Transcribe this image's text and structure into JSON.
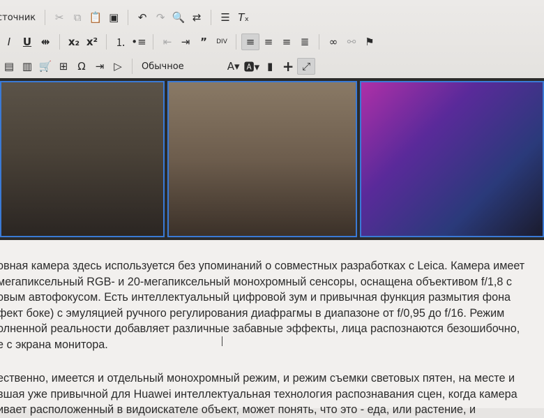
{
  "toolbar": {
    "source_label": "сточник",
    "format_label": "Обычное",
    "row1_icons": [
      "cut-icon",
      "copy-icon",
      "paste-icon",
      "paste-text-icon",
      "paste-word-icon",
      "undo-icon",
      "redo-icon",
      "find-icon",
      "replace-icon",
      "select-all-icon",
      "remove-format-icon"
    ],
    "row2_icons": [
      "italic-icon",
      "underline-icon",
      "strike-icon",
      "subscript-icon",
      "superscript-icon",
      "numbered-list-icon",
      "bulleted-list-icon",
      "outdent-icon",
      "indent-icon",
      "blockquote-icon",
      "div-icon",
      "align-left-icon",
      "align-center-icon",
      "align-right-icon",
      "justify-icon",
      "link-icon",
      "unlink-icon",
      "anchor-icon"
    ],
    "row3_icons": [
      "image-icon",
      "flash-icon",
      "cart-icon",
      "table-icon",
      "special-char-icon",
      "page-break-icon",
      "media-icon",
      "text-color-icon",
      "bg-color-icon",
      "save-icon",
      "add-icon",
      "maximize-icon"
    ]
  },
  "photos": [
    {
      "name": "selfie-photo-1"
    },
    {
      "name": "selfie-photo-2"
    },
    {
      "name": "selfie-photo-3"
    }
  ],
  "article": {
    "para1": [
      "овная камера здесь используется без упоминаний о совместных разработках с Leica. Камера имеет",
      "мегапиксельный RGB- и 20-мегапиксельный монохромный сенсоры, оснащена объективом f/1,8 с",
      "овым автофокусом. Есть интеллектуальный цифровой зум и привычная функция размытия фона",
      "фект боке) с эмуляцией ручного регулирования диафрагмы в диапазоне от f/0,95 до f/16. Режим",
      "олненной реальности добавляет различные забавные эффекты, лица распознаются безошибочно,",
      "е с экрана монитора."
    ],
    "para2": [
      "ественно, имеется и отдельный монохромный режим, и режим съемки световых пятен, на месте и",
      "вшая уже привычной для Huawei интеллектуальная технология распознавания сцен, когда камера",
      "ивает расположенный в видоискателе объект, может понять, что это - еда, или растение, и"
    ]
  }
}
